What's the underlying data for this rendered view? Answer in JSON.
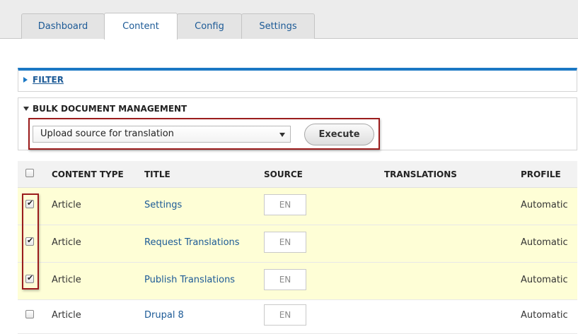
{
  "tabs": [
    {
      "label": "Dashboard"
    },
    {
      "label": "Content",
      "active": true
    },
    {
      "label": "Config"
    },
    {
      "label": "Settings"
    }
  ],
  "filter": {
    "label": "FILTER"
  },
  "bulk": {
    "heading": "BULK DOCUMENT MANAGEMENT",
    "select_value": "Upload source for translation",
    "execute_label": "Execute"
  },
  "table": {
    "headers": {
      "content_type": "CONTENT TYPE",
      "title": "TITLE",
      "source": "SOURCE",
      "translations": "TRANSLATIONS",
      "profile": "PROFILE"
    },
    "rows": [
      {
        "checked": true,
        "content_type": "Article",
        "title": "Settings",
        "source": "EN",
        "profile": "Automatic"
      },
      {
        "checked": true,
        "content_type": "Article",
        "title": "Request Translations",
        "source": "EN",
        "profile": "Automatic"
      },
      {
        "checked": true,
        "content_type": "Article",
        "title": "Publish Translations",
        "source": "EN",
        "profile": "Automatic"
      },
      {
        "checked": false,
        "content_type": "Article",
        "title": "Drupal 8",
        "source": "EN",
        "profile": "Automatic"
      }
    ]
  },
  "colors": {
    "accent": "#1b78c4",
    "link": "#1c5a96",
    "highlight_border": "#9b1c1c",
    "selected_row": "#fefed6"
  },
  "icons": {
    "checkmark": "check-icon",
    "expand": "triangle-right-icon",
    "collapse": "triangle-down-icon",
    "dropdown": "chevron-down-icon"
  }
}
